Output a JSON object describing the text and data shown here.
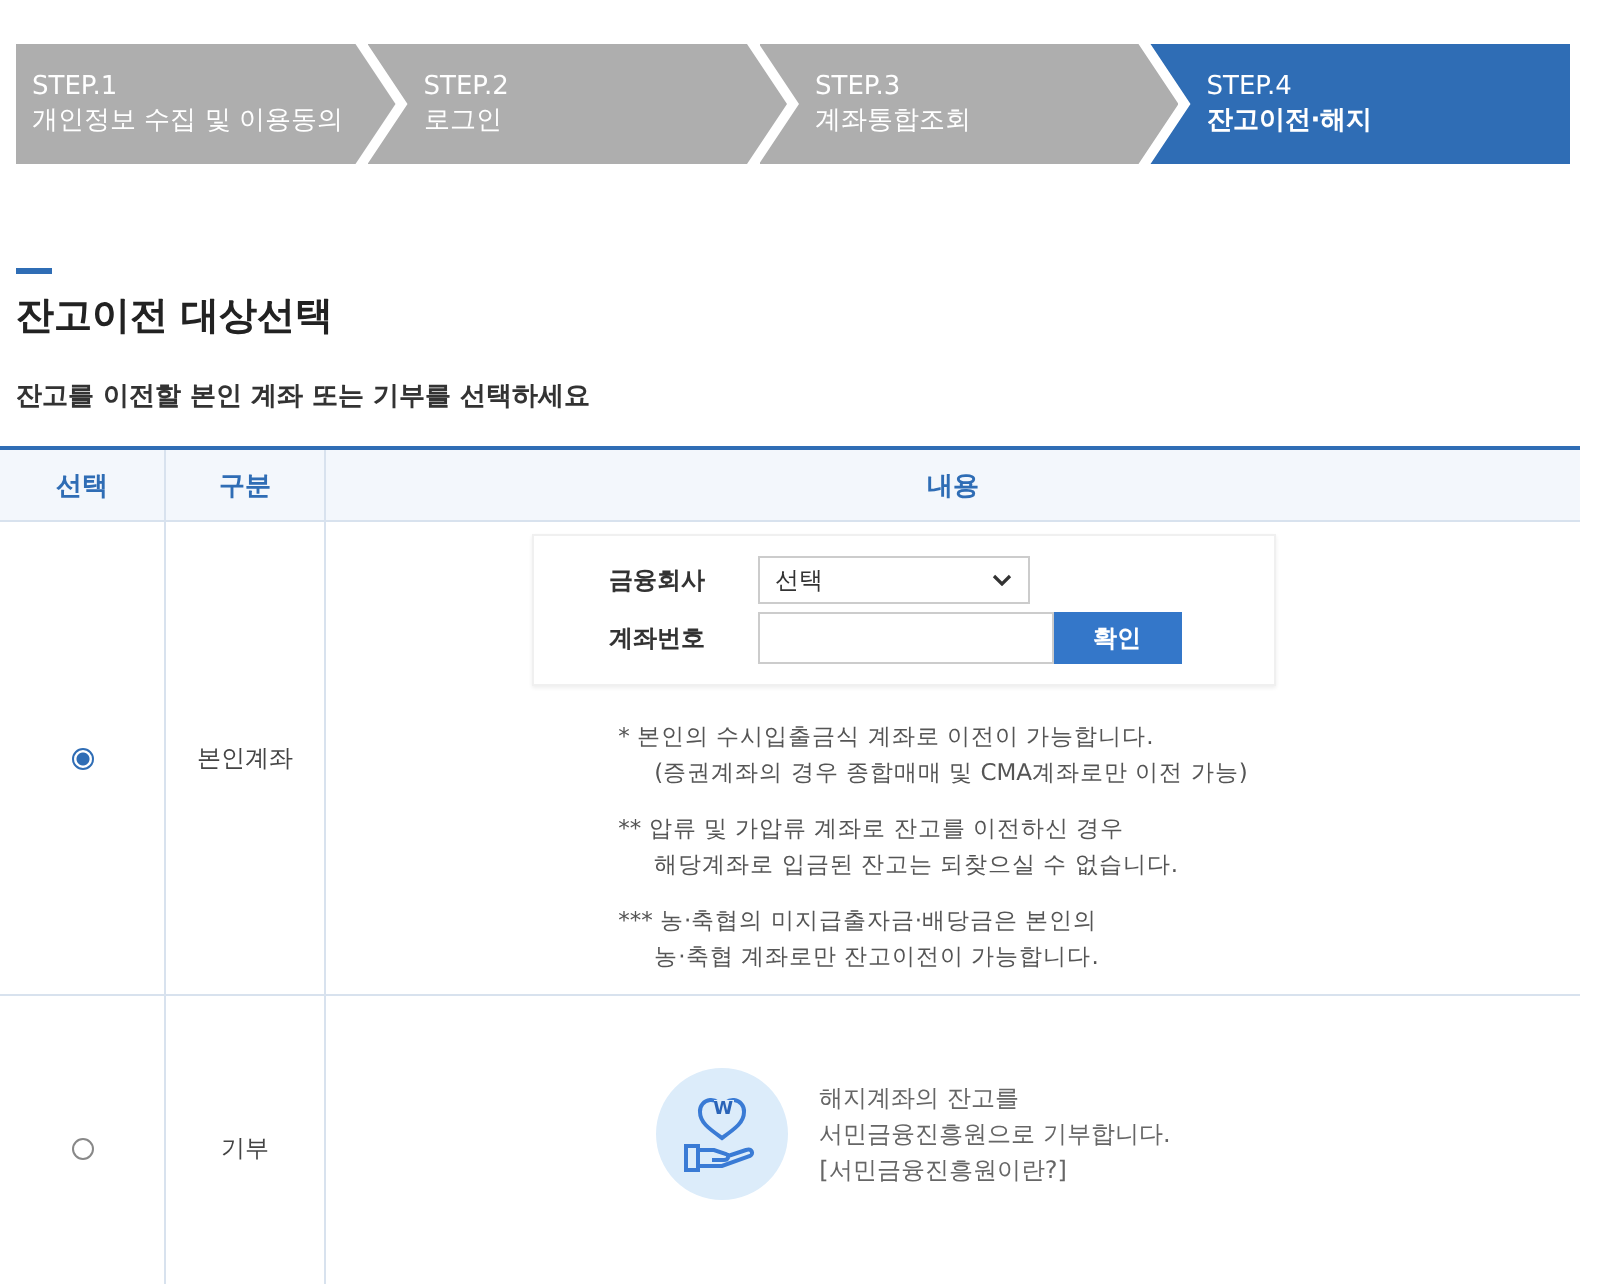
{
  "steps": [
    {
      "number": "STEP.1",
      "label": "개인정보 수집 및 이용동의",
      "selected": false
    },
    {
      "number": "STEP.2",
      "label": "로그인",
      "selected": false
    },
    {
      "number": "STEP.3",
      "label": "계좌통합조회",
      "selected": false
    },
    {
      "number": "STEP.4",
      "label": "잔고이전·해지",
      "selected": true
    }
  ],
  "heading": "잔고이전 대상선택",
  "instruction": "잔고를 이전할 본인 계좌 또는 기부를 선택하세요",
  "table": {
    "columns": [
      "선택",
      "구분",
      "내용"
    ],
    "rows": [
      {
        "kind": "account",
        "selected": true,
        "category": "본인계좌",
        "form": {
          "company_label": "금융회사",
          "company_value": "선택",
          "account_label": "계좌번호",
          "confirm_button": "확인"
        },
        "notes": [
          [
            "* 본인의 수시입출금식 계좌로 이전이 가능합니다.",
            "(증권계좌의 경우 종합매매 및 CMA계좌로만 이전 가능)"
          ],
          [
            "** 압류 및 가압류 계좌로 잔고를 이전하신 경우",
            "해당계좌로 입금된 잔고는 되찾으실 수 없습니다."
          ],
          [
            "*** 농·축협의 미지급출자금·배당금은 본인의",
            "농·축협 계좌로만 잔고이전이 가능합니다."
          ]
        ]
      },
      {
        "kind": "donation",
        "selected": false,
        "category": "기부",
        "icon_text": "W",
        "lines": [
          "해지계좌의 잔고를",
          "서민금융진흥원으로 기부합니다."
        ],
        "link": "[서민금융진흥원이란?]"
      }
    ]
  }
}
